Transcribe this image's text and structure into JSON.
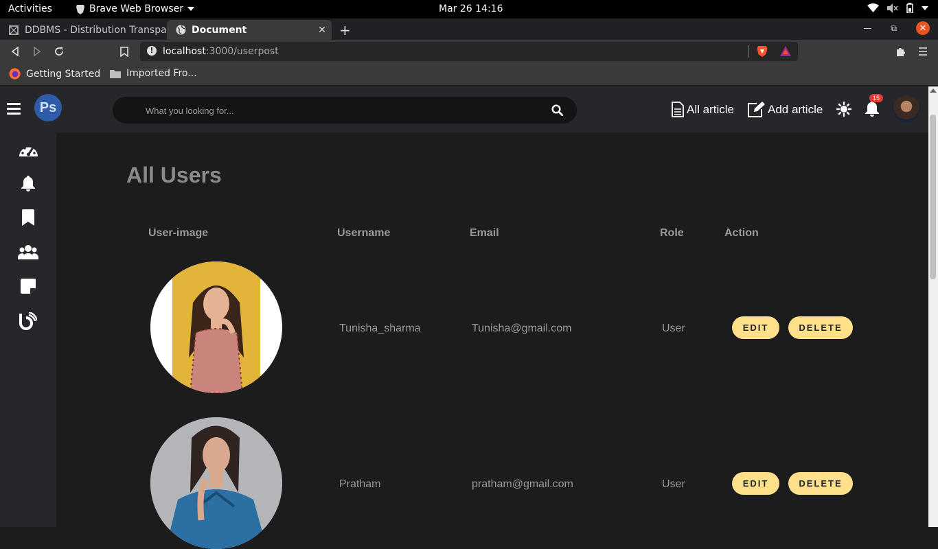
{
  "system": {
    "activities": "Activities",
    "app_name": "Brave Web Browser",
    "clock": "Mar 26  14:16"
  },
  "browser": {
    "tabs": [
      {
        "title": "DDBMS - Distribution Transpa",
        "active": false
      },
      {
        "title": "Document",
        "active": true
      }
    ],
    "url_host": "localhost",
    "url_path": ":3000/userpost",
    "bookmarks": [
      {
        "label": "Getting Started",
        "icon": "firefox-icon"
      },
      {
        "label": "Imported Fro...",
        "icon": "folder-icon"
      }
    ]
  },
  "app": {
    "logo_text": "Ps",
    "search_placeholder": "What you looking for...",
    "nav": {
      "all_article": "All article",
      "add_article": "Add article",
      "notification_count": "15"
    },
    "sidebar_icons": [
      "dashboard-icon",
      "bell-icon",
      "bookmark-icon",
      "users-icon",
      "note-icon",
      "blog-icon"
    ],
    "accent_color": "#ffe08a"
  },
  "page": {
    "title": "All Users",
    "columns": [
      "User-image",
      "Username",
      "Email",
      "Role",
      "Action"
    ],
    "rows": [
      {
        "username": "Tunisha_sharma",
        "email": "Tunisha@gmail.com",
        "role": "User",
        "edit": "EDIT",
        "delete": "DELETE"
      },
      {
        "username": "Pratham",
        "email": "pratham@gmail.com",
        "role": "User",
        "edit": "EDIT",
        "delete": "DELETE"
      }
    ]
  }
}
